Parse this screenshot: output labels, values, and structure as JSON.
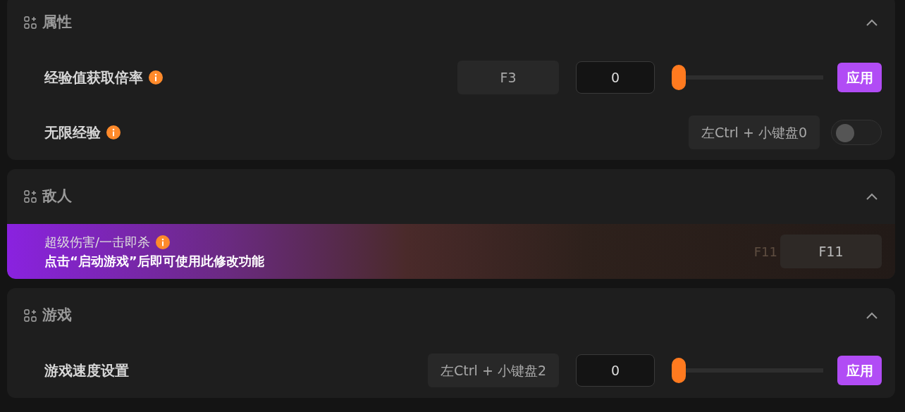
{
  "sections": [
    {
      "title": "属性",
      "expanded": true,
      "rows": [
        {
          "kind": "slider",
          "label": "经验值获取倍率",
          "info": true,
          "hotkey": "F3",
          "value": "0",
          "level": 0,
          "button": "应用"
        },
        {
          "kind": "toggle",
          "label": "无限经验",
          "info": true,
          "hotkey": "左Ctrl + 小键盘0",
          "on": false
        }
      ]
    },
    {
      "title": "敌人",
      "expanded": true,
      "rows": [
        {
          "kind": "banner",
          "label": "超级伤害/一击即杀",
          "info": true,
          "notice": "点击“启动游戏”后即可使用此修改功能",
          "ghost_hotkey": "F11",
          "hotkey": "F11"
        }
      ]
    },
    {
      "title": "游戏",
      "expanded": true,
      "rows": [
        {
          "kind": "slider",
          "label": "游戏速度设置",
          "info": false,
          "hotkey": "左Ctrl + 小键盘2",
          "value": "0",
          "level": 0,
          "button": "应用"
        }
      ]
    }
  ]
}
